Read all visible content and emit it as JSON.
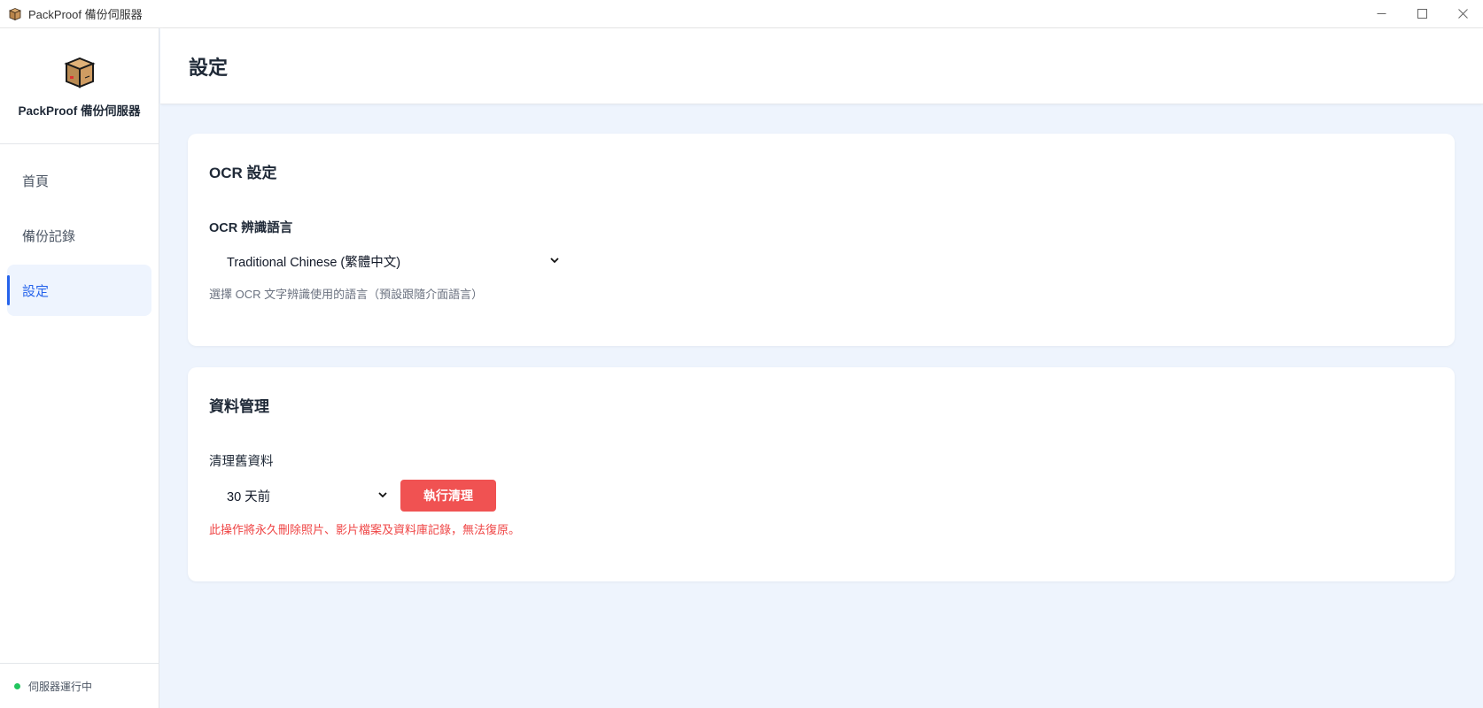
{
  "window": {
    "title": "PackProof 備份伺服器"
  },
  "sidebar": {
    "brand_name": "PackProof 備份伺服器",
    "items": [
      {
        "label": "首頁"
      },
      {
        "label": "備份記錄"
      },
      {
        "label": "設定"
      }
    ],
    "active_item": "設定",
    "status_text": "伺服器運行中"
  },
  "header": {
    "title": "設定"
  },
  "ocr_settings": {
    "title": "OCR 設定",
    "language_label": "OCR 辨識語言",
    "language_value": "Traditional Chinese (繁體中文)",
    "help_text": "選擇 OCR 文字辨識使用的語言（預設跟隨介面語言）"
  },
  "data_management": {
    "title": "資料管理",
    "cleanup_label": "清理舊資料",
    "cleanup_value": "30 天前",
    "cleanup_button": "執行清理",
    "warning_text": "此操作將永久刪除照片、影片檔案及資料庫記錄，無法復原。"
  },
  "colors": {
    "accent": "#2563eb",
    "danger": "#f05252",
    "status_ok": "#22c55e",
    "background": "#eef4fd"
  },
  "icons": {
    "app": "package-box-icon",
    "minimize": "minimize-icon",
    "maximize": "maximize-icon",
    "close": "close-icon",
    "dropdown": "chevron-down-icon"
  }
}
